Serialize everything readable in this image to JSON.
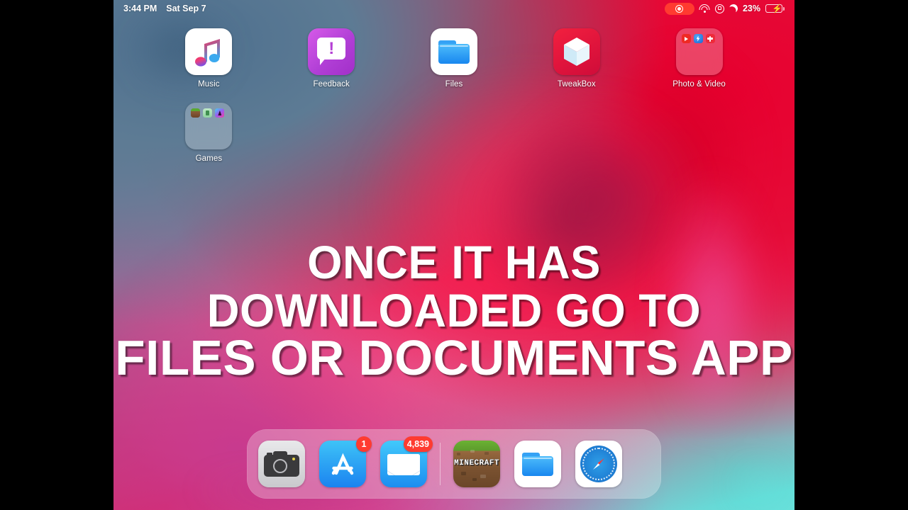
{
  "statusbar": {
    "time": "3:44 PM",
    "date": "Sat Sep 7",
    "battery_percent": "23%",
    "icons": [
      "screen-record-pill",
      "wifi-icon",
      "rotation-lock-icon",
      "do-not-disturb-moon-icon",
      "battery-charging-icon"
    ],
    "battery_level": 23,
    "accent_red": "#ff3b30",
    "battery_green": "#4cd964"
  },
  "homescreen": {
    "apps": [
      {
        "name": "Music",
        "icon": "music-app-icon"
      },
      {
        "name": "Feedback",
        "icon": "feedback-app-icon"
      },
      {
        "name": "Files",
        "icon": "files-app-icon"
      },
      {
        "name": "TweakBox",
        "icon": "tweakbox-app-icon"
      },
      {
        "name": "Photo & Video",
        "icon": "folder-icon"
      },
      {
        "name": "Games",
        "icon": "folder-icon"
      }
    ]
  },
  "dock": {
    "main": [
      {
        "name": "Camera",
        "icon": "camera-app-icon",
        "badge": ""
      },
      {
        "name": "App Store",
        "icon": "appstore-app-icon",
        "badge": "1"
      },
      {
        "name": "Mail",
        "icon": "mail-app-icon",
        "badge": "4,839"
      }
    ],
    "recent": [
      {
        "name": "Minecraft",
        "icon": "minecraft-app-icon",
        "label": "MINECRAFT"
      },
      {
        "name": "Files",
        "icon": "files-app-icon"
      },
      {
        "name": "Safari",
        "icon": "safari-app-icon"
      }
    ]
  },
  "caption": {
    "line1": "ONCE IT HAS",
    "line2": "DOWNLOADED GO TO",
    "line3": "FILES OR DOCUMENTS APP"
  }
}
